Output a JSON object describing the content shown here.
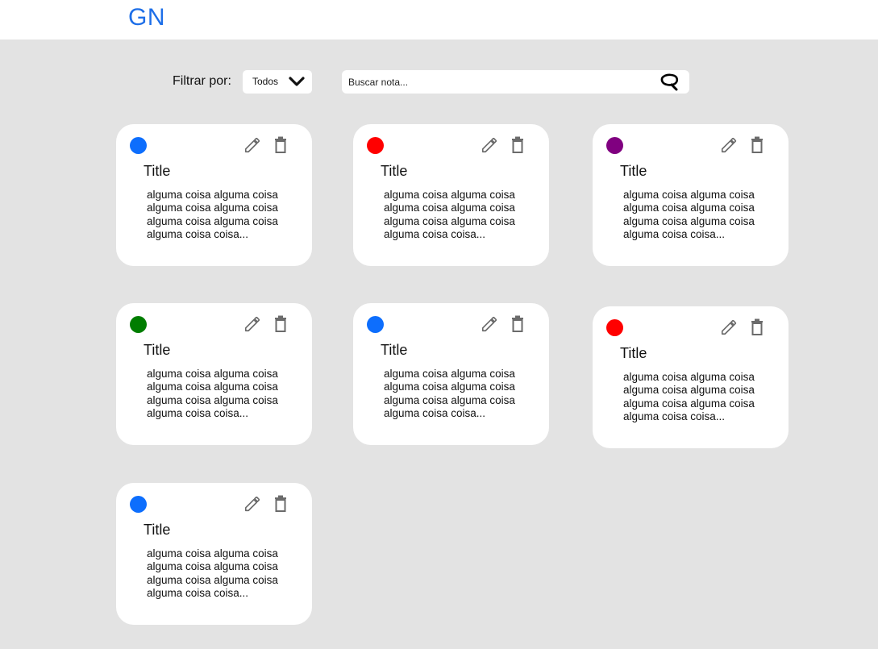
{
  "header": {
    "logo": "GN",
    "logo_color": "#1e6fe8"
  },
  "toolbar": {
    "filter_label": "Filtrar por:",
    "filter_value": "Todos",
    "search_placeholder": "Buscar nota...",
    "search_icon": "search-icon"
  },
  "notes": [
    {
      "color": "#0d6efd",
      "title": "Title",
      "body": "alguma coisa alguma coisa alguma coisa alguma coisa alguma coisa alguma coisa alguma coisa coisa..."
    },
    {
      "color": "#ff0000",
      "title": "Title",
      "body": "alguma coisa alguma coisa alguma coisa alguma coisa alguma coisa alguma coisa alguma coisa coisa..."
    },
    {
      "color": "#800080",
      "title": "Title",
      "body": "alguma coisa alguma coisa alguma coisa alguma coisa alguma coisa alguma coisa alguma coisa coisa..."
    },
    {
      "color": "#007d00",
      "title": "Title",
      "body": "alguma coisa alguma coisa alguma coisa alguma coisa alguma coisa alguma coisa alguma coisa coisa..."
    },
    {
      "color": "#0d6efd",
      "title": "Title",
      "body": "alguma coisa alguma coisa alguma coisa alguma coisa alguma coisa alguma coisa alguma coisa coisa..."
    },
    {
      "color": "#ff0000",
      "title": "Title",
      "body": "alguma coisa alguma coisa alguma coisa alguma coisa alguma coisa alguma coisa alguma coisa coisa..."
    },
    {
      "color": "#0d6efd",
      "title": "Title",
      "body": "alguma coisa alguma coisa alguma coisa alguma coisa alguma coisa alguma coisa alguma coisa coisa..."
    }
  ],
  "icons": {
    "edit": "pencil-icon",
    "delete": "trash-icon",
    "dropdown": "chevron-down-icon"
  }
}
